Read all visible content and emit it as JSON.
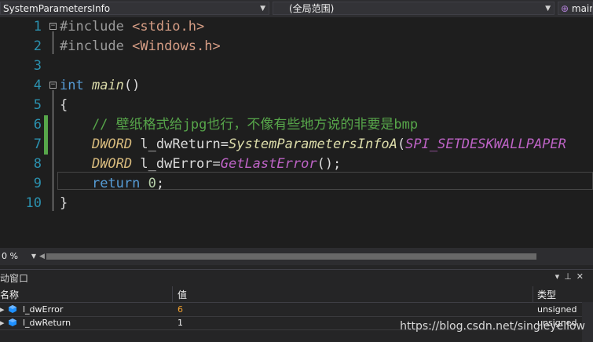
{
  "toolbar": {
    "project_combo": "SystemParametersInfo",
    "scope_combo": "(全局范围)",
    "member_combo": "main"
  },
  "editor": {
    "line_numbers": [
      "1",
      "2",
      "3",
      "4",
      "5",
      "6",
      "7",
      "8",
      "9",
      "10"
    ],
    "lines": [
      {
        "parts": [
          {
            "t": "#include ",
            "c": "pp"
          },
          {
            "t": "<stdio.h>",
            "c": "inc"
          }
        ]
      },
      {
        "parts": [
          {
            "t": "#include ",
            "c": "pp"
          },
          {
            "t": "<Windows.h>",
            "c": "inc"
          }
        ]
      },
      {
        "parts": []
      },
      {
        "parts": [
          {
            "t": "int ",
            "c": "kw"
          },
          {
            "t": "main",
            "c": "fn"
          },
          {
            "t": "()",
            "c": ""
          }
        ]
      },
      {
        "parts": [
          {
            "t": "{",
            "c": ""
          }
        ]
      },
      {
        "parts": [
          {
            "t": "    // 壁纸格式给jpg也行，不像有些地方说的非要是bmp",
            "c": "cm"
          }
        ]
      },
      {
        "parts": [
          {
            "t": "    ",
            "c": ""
          },
          {
            "t": "DWORD",
            "c": "typ"
          },
          {
            "t": " l_dwReturn=",
            "c": ""
          },
          {
            "t": "SystemParametersInfoA",
            "c": "fn"
          },
          {
            "t": "(",
            "c": ""
          },
          {
            "t": "SPI_SETDESKWALLPAPER",
            "c": "mc"
          }
        ]
      },
      {
        "parts": [
          {
            "t": "    ",
            "c": ""
          },
          {
            "t": "DWORD",
            "c": "typ"
          },
          {
            "t": " l_dwError=",
            "c": ""
          },
          {
            "t": "GetLastError",
            "c": "mc"
          },
          {
            "t": "();",
            "c": ""
          }
        ]
      },
      {
        "parts": [
          {
            "t": "    ",
            "c": ""
          },
          {
            "t": "return",
            "c": "kw"
          },
          {
            "t": " ",
            "c": ""
          },
          {
            "t": "0",
            "c": "nm"
          },
          {
            "t": ";",
            "c": ""
          }
        ]
      },
      {
        "parts": [
          {
            "t": "}",
            "c": ""
          }
        ]
      }
    ]
  },
  "status": {
    "zoom": "0 %"
  },
  "autos_panel": {
    "title": "动窗口",
    "columns": [
      "名称",
      "值",
      "类型"
    ],
    "rows": [
      {
        "name": "l_dwError",
        "value": "6",
        "type": "unsigned",
        "value_color": "#f0a030"
      },
      {
        "name": "l_dwReturn",
        "value": "1",
        "type": "unsigned",
        "value_color": "#f1f1f1"
      }
    ]
  },
  "watermark": "https://blog.csdn.net/singleyellow",
  "colors": {
    "background": "#1e1e1e",
    "keyword": "#569cd6",
    "comment": "#57a64a",
    "line_number": "#2b91af"
  }
}
